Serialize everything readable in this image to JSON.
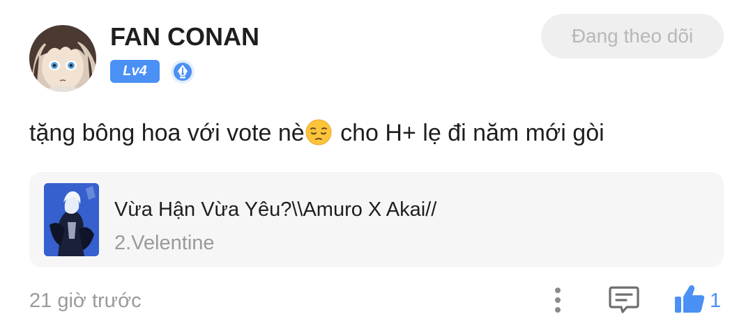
{
  "author": {
    "name": "FAN CONAN",
    "level": "Lv4",
    "verified_icon": "quill-badge-icon",
    "avatar_icon": "anime-avatar"
  },
  "follow_button": {
    "label": "Đang theo dõi",
    "state": "following"
  },
  "post": {
    "text_before_emoji": "tặng bông hoa với vote nè",
    "emoji": "pensive-face",
    "text_after_emoji": " cho H+ lẹ đi năm mới gòi"
  },
  "story": {
    "title": "Vừa Hận Vừa Yêu?\\\\Amuro X Akai//",
    "chapter": "2.Velentine",
    "cover_icon": "story-cover-image"
  },
  "footer": {
    "timestamp": "21 giờ trước",
    "like_count": "1",
    "icons": [
      "more-vertical-icon",
      "comment-icon",
      "thumbs-up-icon"
    ]
  },
  "colors": {
    "accent": "#4a90f5",
    "text": "#1e1e1e",
    "muted": "#9a9a9a",
    "card_bg": "#f6f6f6",
    "button_bg": "#efefef"
  }
}
